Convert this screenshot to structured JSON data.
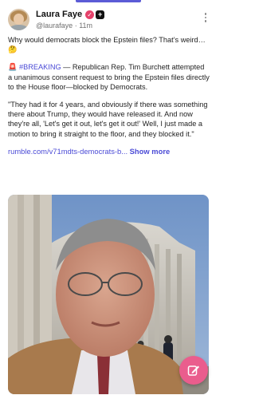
{
  "post": {
    "author_name": "Laura Faye",
    "handle": "@laurafaye",
    "separator": "·",
    "time_ago": "11m",
    "verified_icon": "heart-check-icon",
    "plus_icon": "plus-badge-icon",
    "intro": "Why would democrats block the Epstein files? That’s weird… 🤔",
    "breaking_emoji": "🚨",
    "hashtag": "#BREAKING",
    "breaking_text": " — Republican Rep. Tim Burchett attempted a unanimous consent request to bring the Epstein files directly to the House floor—blocked by Democrats.",
    "quote": "\"They had it for 4 years, and obviously if there was something there about Trump, they would have released it. And now they're all, 'Let's get it out, let's get it out!' Well, I just made a motion to bring it straight to the floor, and they blocked it.\"",
    "link_text": "rumble.com/v71mdts-democrats-b...",
    "show_more": "Show more"
  },
  "media": {
    "type": "video-thumbnail",
    "subject": "man in front of Capitol building"
  },
  "fab": {
    "icon": "compose-icon"
  },
  "colors": {
    "accent": "#4a4ad6",
    "fab": "#ea5d8d",
    "verified": "#e5416a"
  }
}
